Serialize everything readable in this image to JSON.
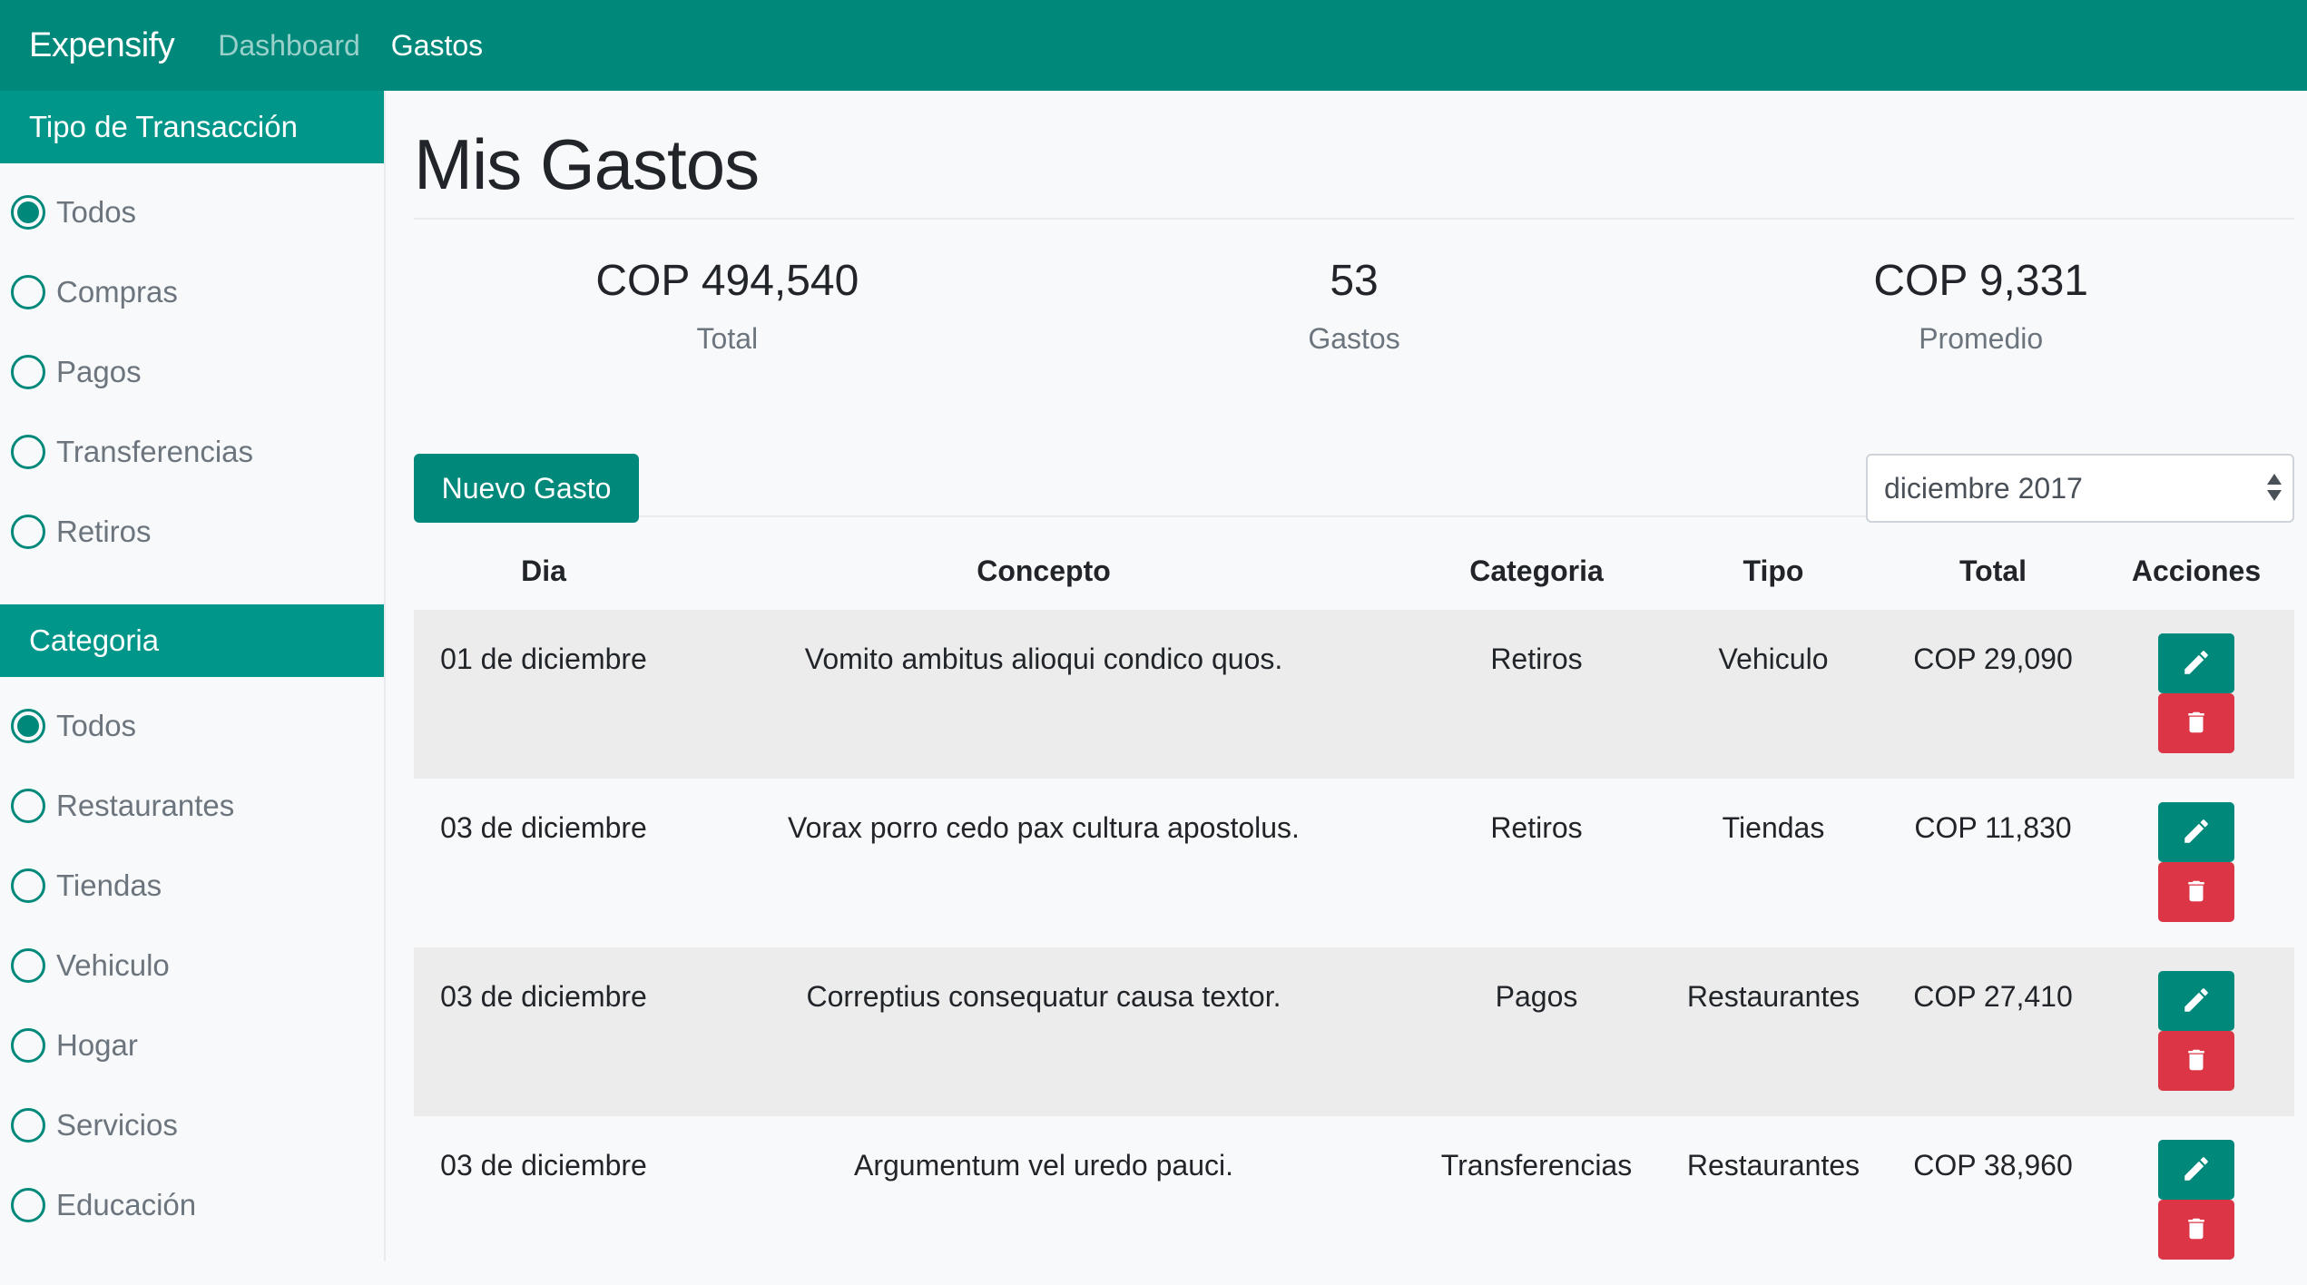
{
  "navbar": {
    "brand": "Expensify",
    "links": [
      "Dashboard",
      "Gastos"
    ],
    "active": "Gastos"
  },
  "sidebar": {
    "tipo_header": "Tipo de Transacción",
    "tipo_items": [
      {
        "label": "Todos",
        "checked": true
      },
      {
        "label": "Compras",
        "checked": false
      },
      {
        "label": "Pagos",
        "checked": false
      },
      {
        "label": "Transferencias",
        "checked": false
      },
      {
        "label": "Retiros",
        "checked": false
      }
    ],
    "categoria_header": "Categoria",
    "categoria_items": [
      {
        "label": "Todos",
        "checked": true
      },
      {
        "label": "Restaurantes",
        "checked": false
      },
      {
        "label": "Tiendas",
        "checked": false
      },
      {
        "label": "Vehiculo",
        "checked": false
      },
      {
        "label": "Hogar",
        "checked": false
      },
      {
        "label": "Servicios",
        "checked": false
      },
      {
        "label": "Educación",
        "checked": false
      }
    ]
  },
  "main": {
    "title": "Mis Gastos",
    "stats": [
      {
        "value": "COP 494,540",
        "label": "Total"
      },
      {
        "value": "53",
        "label": "Gastos"
      },
      {
        "value": "COP 9,331",
        "label": "Promedio"
      }
    ],
    "new_button": "Nuevo Gasto",
    "month_select": "diciembre 2017",
    "table": {
      "headers": [
        "Dia",
        "Concepto",
        "Categoria",
        "Tipo",
        "Total",
        "Acciones"
      ],
      "rows": [
        {
          "dia": "01 de diciembre",
          "concepto": "Vomito ambitus alioqui condico quos.",
          "categoria": "Retiros",
          "tipo": "Vehiculo",
          "total": "COP 29,090"
        },
        {
          "dia": "03 de diciembre",
          "concepto": "Vorax porro cedo pax cultura apostolus.",
          "categoria": "Retiros",
          "tipo": "Tiendas",
          "total": "COP 11,830"
        },
        {
          "dia": "03 de diciembre",
          "concepto": "Correptius consequatur causa textor.",
          "categoria": "Pagos",
          "tipo": "Restaurantes",
          "total": "COP 27,410"
        },
        {
          "dia": "03 de diciembre",
          "concepto": "Argumentum vel uredo pauci.",
          "categoria": "Transferencias",
          "tipo": "Restaurantes",
          "total": "COP 38,960"
        }
      ]
    }
  },
  "colors": {
    "primary": "#00897b",
    "danger": "#dc3545",
    "stripe": "#ececed"
  }
}
